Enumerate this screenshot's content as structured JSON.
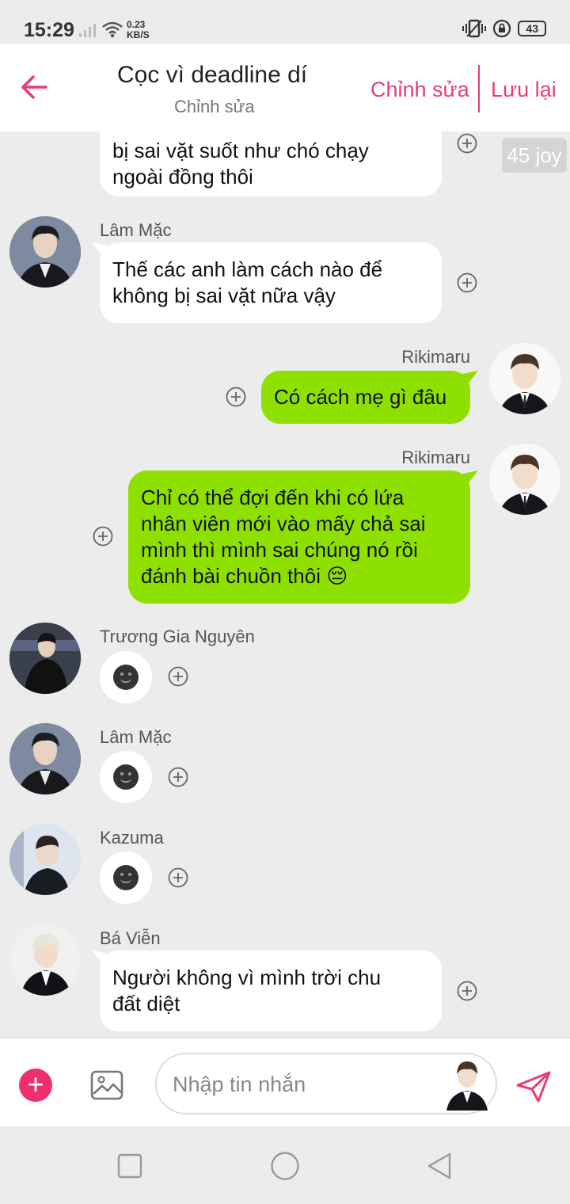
{
  "status_bar": {
    "time": "15:29",
    "net_speed_value": "0.23",
    "net_speed_unit": "KB/S",
    "battery": "43"
  },
  "header": {
    "title": "Cọc vì deadline dí",
    "subtitle": "Chỉnh sửa",
    "edit_label": "Chỉnh sửa",
    "save_label": "Lưu lại"
  },
  "badge": {
    "joy": "45 joy"
  },
  "messages": [
    {
      "lines": [
        "bị sai vặt suốt như chó chạy",
        "ngoài đồng thôi"
      ]
    },
    {
      "sender": "Lâm Mặc",
      "lines": [
        "Thế các anh làm cách nào để",
        "không bị sai vặt nữa vậy"
      ]
    },
    {
      "sender": "Rikimaru",
      "lines": [
        "Có cách mẹ gì đâu"
      ]
    },
    {
      "sender": "Rikimaru",
      "lines": [
        "Chỉ có thể đợi đến khi có lứa",
        "nhân viên mới vào mấy chả sai",
        "mình thì mình sai chúng nó rồi",
        "đánh bài chuồn thôi 😔"
      ]
    },
    {
      "sender": "Trương Gia Nguyên"
    },
    {
      "sender": "Lâm Mặc"
    },
    {
      "sender": "Kazuma"
    },
    {
      "sender": "Bá Viễn",
      "lines": [
        "Người không vì mình trời chu",
        "đất diệt"
      ]
    }
  ],
  "input": {
    "placeholder": "Nhập tin nhắn"
  },
  "colors": {
    "accent": "#e73c7e",
    "sent_bubble": "#8ee000",
    "received_bubble": "#ffffff",
    "background": "#ececec"
  }
}
